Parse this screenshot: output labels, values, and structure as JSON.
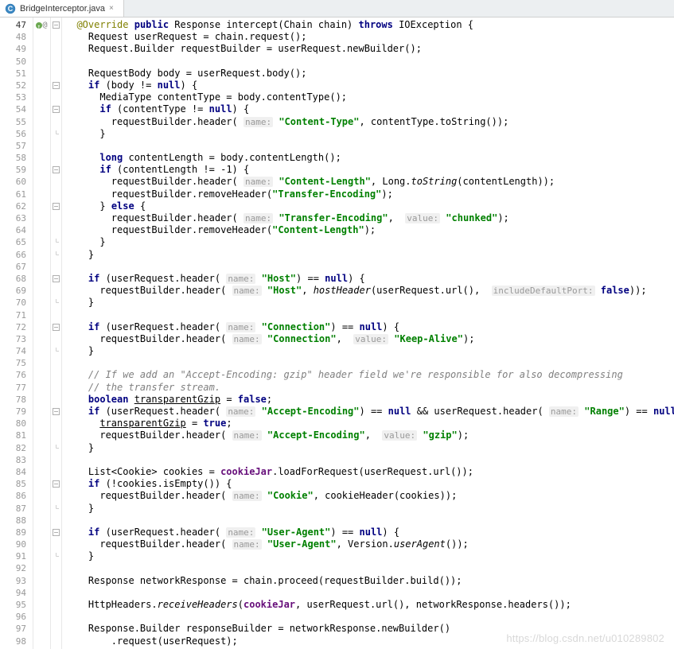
{
  "tab": {
    "filename": "BridgeInterceptor.java",
    "close_glyph": "×"
  },
  "watermark": "https://blog.csdn.net/u010289802",
  "gutter": {
    "start": 47,
    "end": 98
  },
  "code_lines": [
    {
      "n": 47,
      "indent": "  ",
      "segs": [
        {
          "t": "@Override",
          "c": "ann"
        },
        {
          "t": " "
        },
        {
          "t": "public",
          "c": "kw"
        },
        {
          "t": " Response intercept(Chain chain) "
        },
        {
          "t": "throws",
          "c": "kw"
        },
        {
          "t": " IOException {"
        }
      ],
      "fold": "−",
      "marker": "override"
    },
    {
      "n": 48,
      "indent": "    ",
      "segs": [
        {
          "t": "Request userRequest = chain.request();"
        }
      ]
    },
    {
      "n": 49,
      "indent": "    ",
      "segs": [
        {
          "t": "Request.Builder requestBuilder = userRequest.newBuilder();"
        }
      ]
    },
    {
      "n": 50,
      "indent": "",
      "segs": []
    },
    {
      "n": 51,
      "indent": "    ",
      "segs": [
        {
          "t": "RequestBody body = userRequest.body();"
        }
      ]
    },
    {
      "n": 52,
      "indent": "    ",
      "segs": [
        {
          "t": "if",
          "c": "kw"
        },
        {
          "t": " (body != "
        },
        {
          "t": "null",
          "c": "kw"
        },
        {
          "t": ") {"
        }
      ],
      "fold": "−"
    },
    {
      "n": 53,
      "indent": "      ",
      "segs": [
        {
          "t": "MediaType contentType = body.contentType();"
        }
      ]
    },
    {
      "n": 54,
      "indent": "      ",
      "segs": [
        {
          "t": "if",
          "c": "kw"
        },
        {
          "t": " (contentType != "
        },
        {
          "t": "null",
          "c": "kw"
        },
        {
          "t": ") {"
        }
      ],
      "fold": "−"
    },
    {
      "n": 55,
      "indent": "        ",
      "segs": [
        {
          "t": "requestBuilder.header( "
        },
        {
          "t": "name:",
          "c": "hint"
        },
        {
          "t": " "
        },
        {
          "t": "\"Content-Type\"",
          "c": "str"
        },
        {
          "t": ", contentType.toString());"
        }
      ]
    },
    {
      "n": 56,
      "indent": "      ",
      "segs": [
        {
          "t": "}"
        }
      ],
      "fold": "e"
    },
    {
      "n": 57,
      "indent": "",
      "segs": []
    },
    {
      "n": 58,
      "indent": "      ",
      "segs": [
        {
          "t": "long",
          "c": "kw"
        },
        {
          "t": " contentLength = body.contentLength();"
        }
      ]
    },
    {
      "n": 59,
      "indent": "      ",
      "segs": [
        {
          "t": "if",
          "c": "kw"
        },
        {
          "t": " (contentLength != -"
        },
        {
          "t": "1",
          "c": "num"
        },
        {
          "t": ") {"
        }
      ],
      "fold": "−"
    },
    {
      "n": 60,
      "indent": "        ",
      "segs": [
        {
          "t": "requestBuilder.header( "
        },
        {
          "t": "name:",
          "c": "hint"
        },
        {
          "t": " "
        },
        {
          "t": "\"Content-Length\"",
          "c": "str"
        },
        {
          "t": ", Long."
        },
        {
          "t": "toString",
          "c": "call-static"
        },
        {
          "t": "(contentLength));"
        }
      ]
    },
    {
      "n": 61,
      "indent": "        ",
      "segs": [
        {
          "t": "requestBuilder.removeHeader("
        },
        {
          "t": "\"Transfer-Encoding\"",
          "c": "str"
        },
        {
          "t": ");"
        }
      ]
    },
    {
      "n": 62,
      "indent": "      ",
      "segs": [
        {
          "t": "} "
        },
        {
          "t": "else",
          "c": "kw"
        },
        {
          "t": " {"
        }
      ],
      "fold": "−"
    },
    {
      "n": 63,
      "indent": "        ",
      "segs": [
        {
          "t": "requestBuilder.header( "
        },
        {
          "t": "name:",
          "c": "hint"
        },
        {
          "t": " "
        },
        {
          "t": "\"Transfer-Encoding\"",
          "c": "str"
        },
        {
          "t": ",  "
        },
        {
          "t": "value:",
          "c": "hint"
        },
        {
          "t": " "
        },
        {
          "t": "\"chunked\"",
          "c": "str"
        },
        {
          "t": ");"
        }
      ]
    },
    {
      "n": 64,
      "indent": "        ",
      "segs": [
        {
          "t": "requestBuilder.removeHeader("
        },
        {
          "t": "\"Content-Length\"",
          "c": "str"
        },
        {
          "t": ");"
        }
      ]
    },
    {
      "n": 65,
      "indent": "      ",
      "segs": [
        {
          "t": "}"
        }
      ],
      "fold": "e"
    },
    {
      "n": 66,
      "indent": "    ",
      "segs": [
        {
          "t": "}"
        }
      ],
      "fold": "e"
    },
    {
      "n": 67,
      "indent": "",
      "segs": []
    },
    {
      "n": 68,
      "indent": "    ",
      "segs": [
        {
          "t": "if",
          "c": "kw"
        },
        {
          "t": " (userRequest.header( "
        },
        {
          "t": "name:",
          "c": "hint"
        },
        {
          "t": " "
        },
        {
          "t": "\"Host\"",
          "c": "str"
        },
        {
          "t": ") == "
        },
        {
          "t": "null",
          "c": "kw"
        },
        {
          "t": ") {"
        }
      ],
      "fold": "−"
    },
    {
      "n": 69,
      "indent": "      ",
      "segs": [
        {
          "t": "requestBuilder.header( "
        },
        {
          "t": "name:",
          "c": "hint"
        },
        {
          "t": " "
        },
        {
          "t": "\"Host\"",
          "c": "str"
        },
        {
          "t": ", "
        },
        {
          "t": "hostHeader",
          "c": "call-static"
        },
        {
          "t": "(userRequest.url(),  "
        },
        {
          "t": "includeDefaultPort:",
          "c": "hint"
        },
        {
          "t": " "
        },
        {
          "t": "false",
          "c": "false"
        },
        {
          "t": "));"
        }
      ]
    },
    {
      "n": 70,
      "indent": "    ",
      "segs": [
        {
          "t": "}"
        }
      ],
      "fold": "e"
    },
    {
      "n": 71,
      "indent": "",
      "segs": []
    },
    {
      "n": 72,
      "indent": "    ",
      "segs": [
        {
          "t": "if",
          "c": "kw"
        },
        {
          "t": " (userRequest.header( "
        },
        {
          "t": "name:",
          "c": "hint"
        },
        {
          "t": " "
        },
        {
          "t": "\"Connection\"",
          "c": "str"
        },
        {
          "t": ") == "
        },
        {
          "t": "null",
          "c": "kw"
        },
        {
          "t": ") {"
        }
      ],
      "fold": "−"
    },
    {
      "n": 73,
      "indent": "      ",
      "segs": [
        {
          "t": "requestBuilder.header( "
        },
        {
          "t": "name:",
          "c": "hint"
        },
        {
          "t": " "
        },
        {
          "t": "\"Connection\"",
          "c": "str"
        },
        {
          "t": ",  "
        },
        {
          "t": "value:",
          "c": "hint"
        },
        {
          "t": " "
        },
        {
          "t": "\"Keep-Alive\"",
          "c": "str"
        },
        {
          "t": ");"
        }
      ]
    },
    {
      "n": 74,
      "indent": "    ",
      "segs": [
        {
          "t": "}"
        }
      ],
      "fold": "e"
    },
    {
      "n": 75,
      "indent": "",
      "segs": []
    },
    {
      "n": 76,
      "indent": "    ",
      "segs": [
        {
          "t": "// If we add an \"Accept-Encoding: gzip\" header field we're responsible for also decompressing",
          "c": "com"
        }
      ]
    },
    {
      "n": 77,
      "indent": "    ",
      "segs": [
        {
          "t": "// the transfer stream.",
          "c": "com"
        }
      ]
    },
    {
      "n": 78,
      "indent": "    ",
      "segs": [
        {
          "t": "boolean",
          "c": "kw"
        },
        {
          "t": " "
        },
        {
          "t": "transparentGzip",
          "c": "underline"
        },
        {
          "t": " = "
        },
        {
          "t": "false",
          "c": "false"
        },
        {
          "t": ";"
        }
      ]
    },
    {
      "n": 79,
      "indent": "    ",
      "segs": [
        {
          "t": "if",
          "c": "kw"
        },
        {
          "t": " (userRequest.header( "
        },
        {
          "t": "name:",
          "c": "hint"
        },
        {
          "t": " "
        },
        {
          "t": "\"Accept-Encoding\"",
          "c": "str"
        },
        {
          "t": ") == "
        },
        {
          "t": "null",
          "c": "kw"
        },
        {
          "t": " && userRequest.header( "
        },
        {
          "t": "name:",
          "c": "hint"
        },
        {
          "t": " "
        },
        {
          "t": "\"Range\"",
          "c": "str"
        },
        {
          "t": ") == "
        },
        {
          "t": "null",
          "c": "kw"
        },
        {
          "t": ") {"
        }
      ],
      "fold": "−"
    },
    {
      "n": 80,
      "indent": "      ",
      "segs": [
        {
          "t": "transparentGzip",
          "c": "underline"
        },
        {
          "t": " = "
        },
        {
          "t": "true",
          "c": "false"
        },
        {
          "t": ";"
        }
      ]
    },
    {
      "n": 81,
      "indent": "      ",
      "segs": [
        {
          "t": "requestBuilder.header( "
        },
        {
          "t": "name:",
          "c": "hint"
        },
        {
          "t": " "
        },
        {
          "t": "\"Accept-Encoding\"",
          "c": "str"
        },
        {
          "t": ",  "
        },
        {
          "t": "value:",
          "c": "hint"
        },
        {
          "t": " "
        },
        {
          "t": "\"gzip\"",
          "c": "str"
        },
        {
          "t": ");"
        }
      ]
    },
    {
      "n": 82,
      "indent": "    ",
      "segs": [
        {
          "t": "}"
        }
      ],
      "fold": "e"
    },
    {
      "n": 83,
      "indent": "",
      "segs": []
    },
    {
      "n": 84,
      "indent": "    ",
      "segs": [
        {
          "t": "List<Cookie> cookies = "
        },
        {
          "t": "cookieJar",
          "c": "field"
        },
        {
          "t": ".loadForRequest(userRequest.url());"
        }
      ]
    },
    {
      "n": 85,
      "indent": "    ",
      "segs": [
        {
          "t": "if",
          "c": "kw"
        },
        {
          "t": " (!cookies.isEmpty()) {"
        }
      ],
      "fold": "−"
    },
    {
      "n": 86,
      "indent": "      ",
      "segs": [
        {
          "t": "requestBuilder.header( "
        },
        {
          "t": "name:",
          "c": "hint"
        },
        {
          "t": " "
        },
        {
          "t": "\"Cookie\"",
          "c": "str"
        },
        {
          "t": ", cookieHeader(cookies));"
        }
      ]
    },
    {
      "n": 87,
      "indent": "    ",
      "segs": [
        {
          "t": "}"
        }
      ],
      "fold": "e"
    },
    {
      "n": 88,
      "indent": "",
      "segs": []
    },
    {
      "n": 89,
      "indent": "    ",
      "segs": [
        {
          "t": "if",
          "c": "kw"
        },
        {
          "t": " (userRequest.header( "
        },
        {
          "t": "name:",
          "c": "hint"
        },
        {
          "t": " "
        },
        {
          "t": "\"User-Agent\"",
          "c": "str"
        },
        {
          "t": ") == "
        },
        {
          "t": "null",
          "c": "kw"
        },
        {
          "t": ") {"
        }
      ],
      "fold": "−"
    },
    {
      "n": 90,
      "indent": "      ",
      "segs": [
        {
          "t": "requestBuilder.header( "
        },
        {
          "t": "name:",
          "c": "hint"
        },
        {
          "t": " "
        },
        {
          "t": "\"User-Agent\"",
          "c": "str"
        },
        {
          "t": ", Version."
        },
        {
          "t": "userAgent",
          "c": "call-static"
        },
        {
          "t": "());"
        }
      ]
    },
    {
      "n": 91,
      "indent": "    ",
      "segs": [
        {
          "t": "}"
        }
      ],
      "fold": "e"
    },
    {
      "n": 92,
      "indent": "",
      "segs": []
    },
    {
      "n": 93,
      "indent": "    ",
      "segs": [
        {
          "t": "Response networkResponse = chain.proceed(requestBuilder.build());"
        }
      ]
    },
    {
      "n": 94,
      "indent": "",
      "segs": []
    },
    {
      "n": 95,
      "indent": "    ",
      "segs": [
        {
          "t": "HttpHeaders."
        },
        {
          "t": "receiveHeaders",
          "c": "call-static"
        },
        {
          "t": "("
        },
        {
          "t": "cookieJar",
          "c": "field"
        },
        {
          "t": ", userRequest.url(), networkResponse.headers());"
        }
      ]
    },
    {
      "n": 96,
      "indent": "",
      "segs": []
    },
    {
      "n": 97,
      "indent": "    ",
      "segs": [
        {
          "t": "Response.Builder responseBuilder = networkResponse.newBuilder()"
        }
      ]
    },
    {
      "n": 98,
      "indent": "        ",
      "segs": [
        {
          "t": ".request(userRequest);"
        }
      ]
    }
  ]
}
